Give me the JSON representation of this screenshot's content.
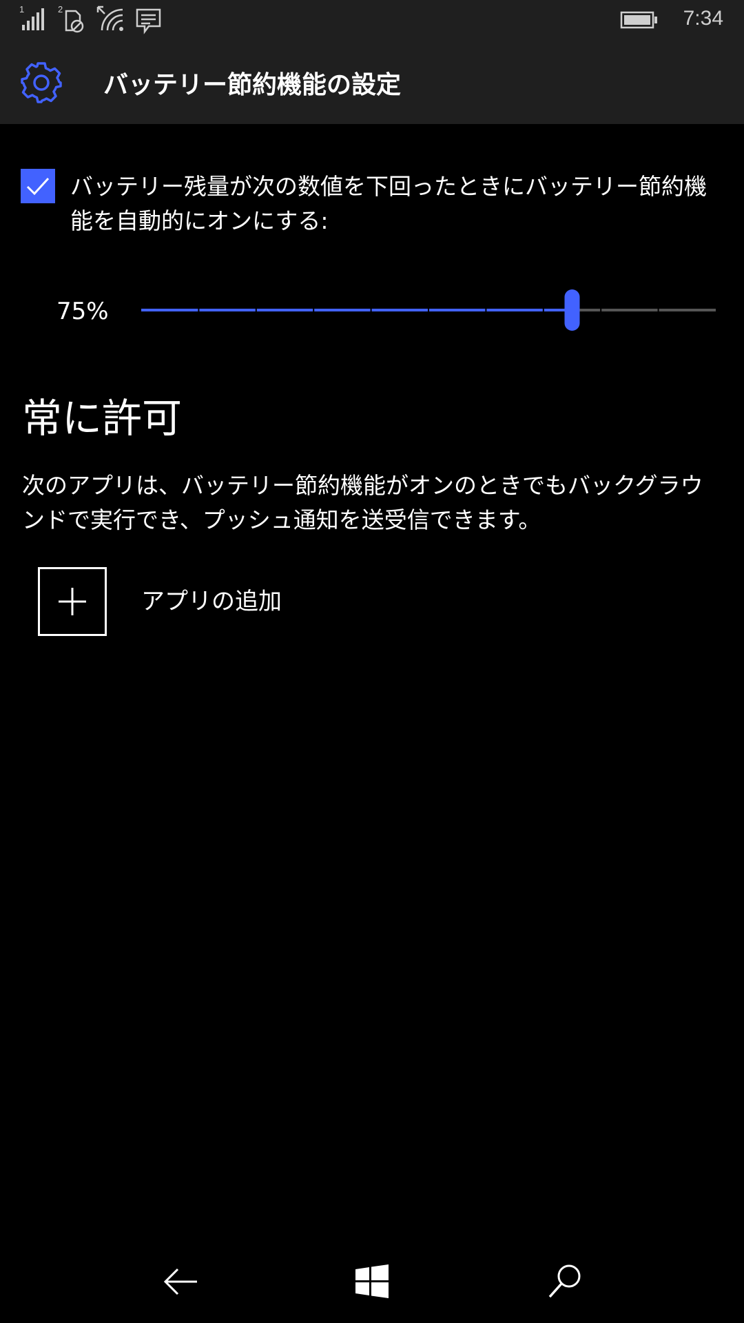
{
  "status_bar": {
    "time": "7:34",
    "sim1_label": "1",
    "sim2_label": "2",
    "icons": [
      "signal-icon",
      "sim-no-service-icon",
      "wifi-icon",
      "message-icon",
      "battery-icon"
    ]
  },
  "header": {
    "title": "バッテリー節約機能の設定",
    "icon": "gear-icon",
    "accent_color": "#4262ff"
  },
  "auto_saver": {
    "checked": true,
    "label": "バッテリー残量が次の数値を下回ったときにバッテリー節約機能を自動的にオンにする:"
  },
  "slider": {
    "value_label": "75%",
    "value_fraction": 0.75,
    "accent_color": "#4262ff",
    "track_color": "#555555"
  },
  "always_allowed": {
    "heading": "常に許可",
    "description": "次のアプリは、バッテリー節約機能がオンのときでもバックグラウンドで実行でき、プッシュ通知を送受信できます。",
    "add_app_label": "アプリの追加",
    "add_icon": "plus-icon"
  },
  "nav_bar": {
    "icons": [
      "back-arrow-icon",
      "windows-logo-icon",
      "search-icon"
    ]
  }
}
